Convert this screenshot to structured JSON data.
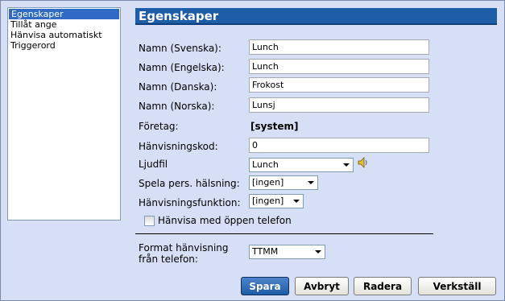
{
  "sidebar": {
    "items": [
      {
        "label": "Egenskaper",
        "selected": true
      },
      {
        "label": "Tillåt ange"
      },
      {
        "label": "Hänvisa automatiskt"
      },
      {
        "label": "Triggerord"
      }
    ]
  },
  "header": {
    "title": "Egenskaper"
  },
  "form": {
    "name_sv": {
      "label": "Namn (Svenska):",
      "value": "Lunch"
    },
    "name_en": {
      "label": "Namn (Engelska):",
      "value": "Lunch"
    },
    "name_da": {
      "label": "Namn (Danska):",
      "value": "Frokost"
    },
    "name_no": {
      "label": "Namn (Norska):",
      "value": "Lunsj"
    },
    "company": {
      "label": "Företag:",
      "value": "[system]"
    },
    "ref_code": {
      "label": "Hänvisningskod:",
      "value": "0"
    },
    "sound": {
      "label": "Ljudfil",
      "value": "Lunch"
    },
    "greeting": {
      "label": "Spela pers. hälsning:",
      "value": "[ingen]"
    },
    "ref_function": {
      "label": "Hänvisningsfunktion:",
      "value": "[ingen]"
    },
    "open_phone": {
      "label": "Hänvisa med öppen telefon",
      "checked": false
    },
    "format": {
      "label_line1": "Format hänvisning",
      "label_line2": "från telefon:",
      "value": "TTMM"
    }
  },
  "buttons": {
    "save": "Spara",
    "cancel": "Avbryt",
    "delete": "Radera",
    "apply": "Verkställ"
  },
  "colors": {
    "header_bg": "#1d5ca6",
    "window_bg": "#d6dff5",
    "selection": "#316ac5"
  },
  "icons": {
    "sound": "speaker-icon"
  }
}
